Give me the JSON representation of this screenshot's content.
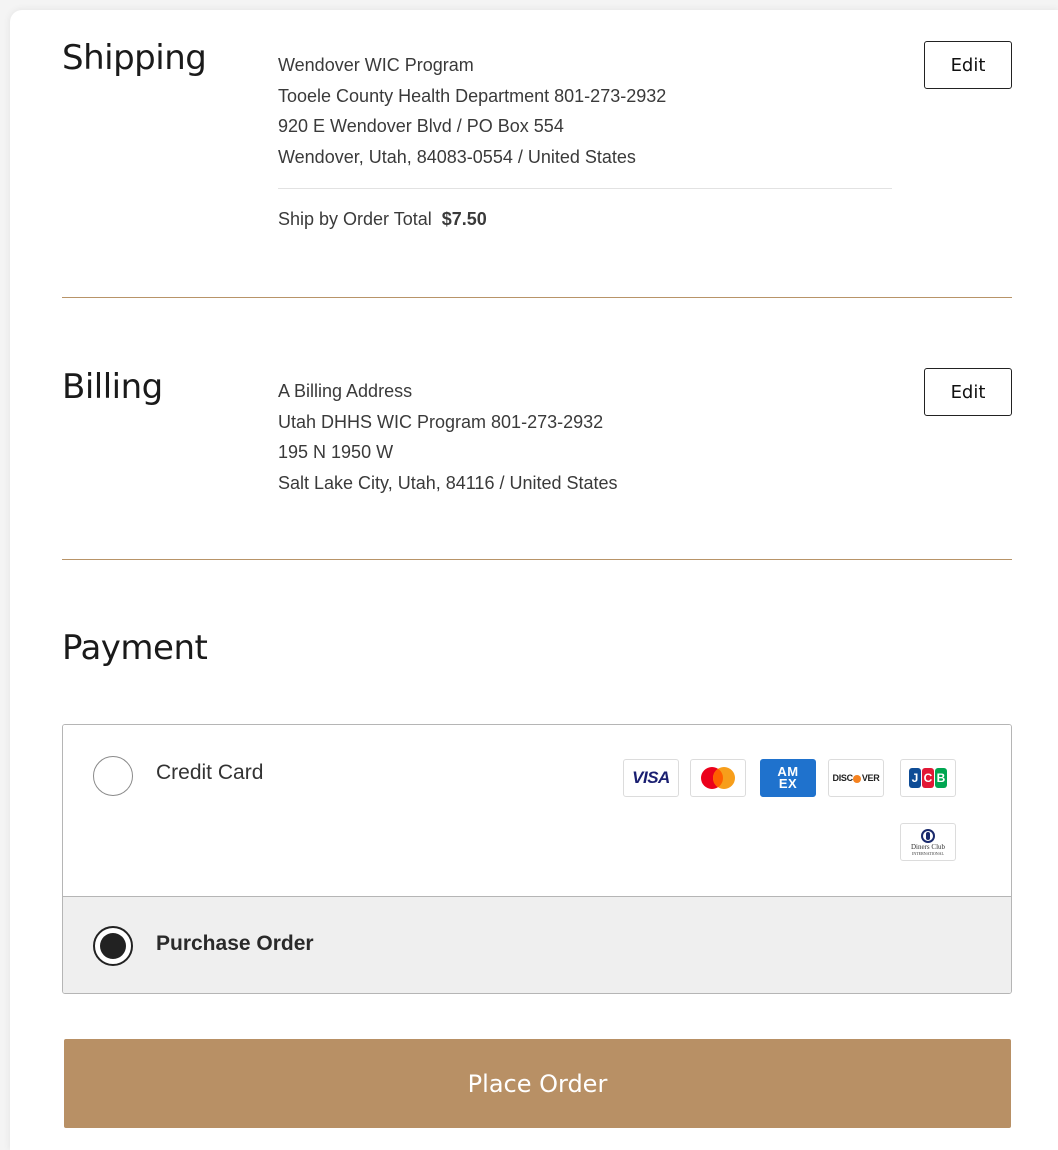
{
  "shipping": {
    "title": "Shipping",
    "address_lines": [
      "Wendover WIC Program",
      "Tooele County Health Department 801-273-2932",
      "920 E Wendover Blvd / PO Box 554",
      "Wendover, Utah, 84083-0554 / United States"
    ],
    "edit_label": "Edit",
    "method_label": "Ship by Order Total",
    "method_price": "$7.50"
  },
  "billing": {
    "title": "Billing",
    "address_lines": [
      "A Billing Address",
      "Utah DHHS WIC Program 801-273-2932",
      "195 N 1950 W",
      "Salt Lake City, Utah, 84116 / United States"
    ],
    "edit_label": "Edit"
  },
  "payment": {
    "title": "Payment",
    "options": [
      {
        "label": "Credit Card",
        "selected": false,
        "card_logos": [
          "visa",
          "mastercard",
          "amex",
          "discover",
          "jcb",
          "diners-club"
        ]
      },
      {
        "label": "Purchase Order",
        "selected": true
      }
    ]
  },
  "logo_text": {
    "visa": "VISA",
    "amex_top": "AM",
    "amex_bottom": "EX",
    "discover_pre": "DISC",
    "discover_post": "VER",
    "jcb": [
      "J",
      "C",
      "B"
    ],
    "diners_line1": "Diners Club",
    "diners_line2": "INTERNATIONAL"
  },
  "place_order_label": "Place Order",
  "colors": {
    "accent": "#b89065",
    "divider": "#b89468",
    "selected_bg": "#efefef"
  }
}
